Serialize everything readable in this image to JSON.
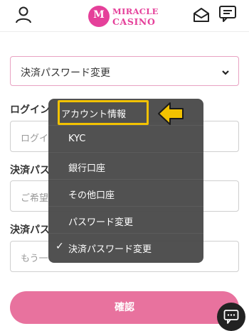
{
  "header": {
    "logo_mark": "M",
    "logo_line1": "MIRACLE",
    "logo_line2": "CASINO",
    "icons": [
      "user-icon",
      "envelope-open-icon",
      "chat-icon"
    ]
  },
  "page_select": {
    "value": "決済パスワード変更",
    "chevron": "chevron-down-icon"
  },
  "form": {
    "login_label": "ログイン",
    "login_placeholder": "ログイ",
    "new_pw_label": "決済パス",
    "new_pw_placeholder": "ご希望",
    "confirm_pw_label": "決済パス",
    "confirm_pw_placeholder": "もう一",
    "confirm_button": "確認"
  },
  "menu": {
    "items": [
      {
        "label": "アカウント情報",
        "highlighted": true
      },
      {
        "label": "KYC"
      },
      {
        "label": "銀行口座"
      },
      {
        "label": "その他口座"
      },
      {
        "label": "パスワード変更"
      },
      {
        "label": "決済パスワード変更",
        "selected": true,
        "check": "✓"
      }
    ]
  },
  "colors": {
    "brand": "#e5409a",
    "button": "#e8729e",
    "highlight": "#f2c200",
    "menu_bg": "#4a4a4a"
  }
}
